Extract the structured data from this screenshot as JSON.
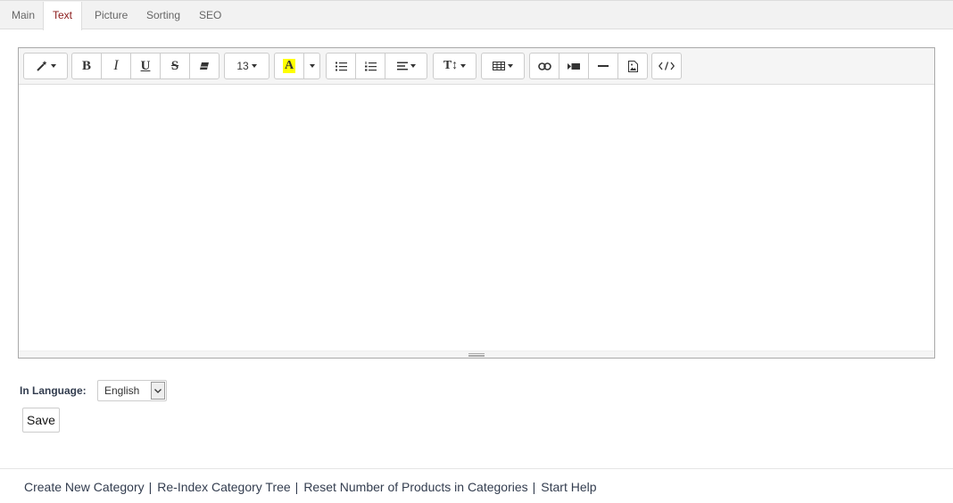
{
  "tabs": [
    {
      "label": "Main"
    },
    {
      "label": "Text"
    },
    {
      "label": "Picture"
    },
    {
      "label": "Sorting"
    },
    {
      "label": "SEO"
    }
  ],
  "active_tab": "Text",
  "toolbar": {
    "font_size": "13",
    "highlight_color": "#ffff00"
  },
  "language": {
    "label": "In Language:",
    "value": "English"
  },
  "save_label": "Save",
  "footer": {
    "links": [
      "Create New Category",
      "Re-Index Category Tree",
      "Reset Number of Products in Categories",
      "Start Help"
    ],
    "separator": "|"
  }
}
